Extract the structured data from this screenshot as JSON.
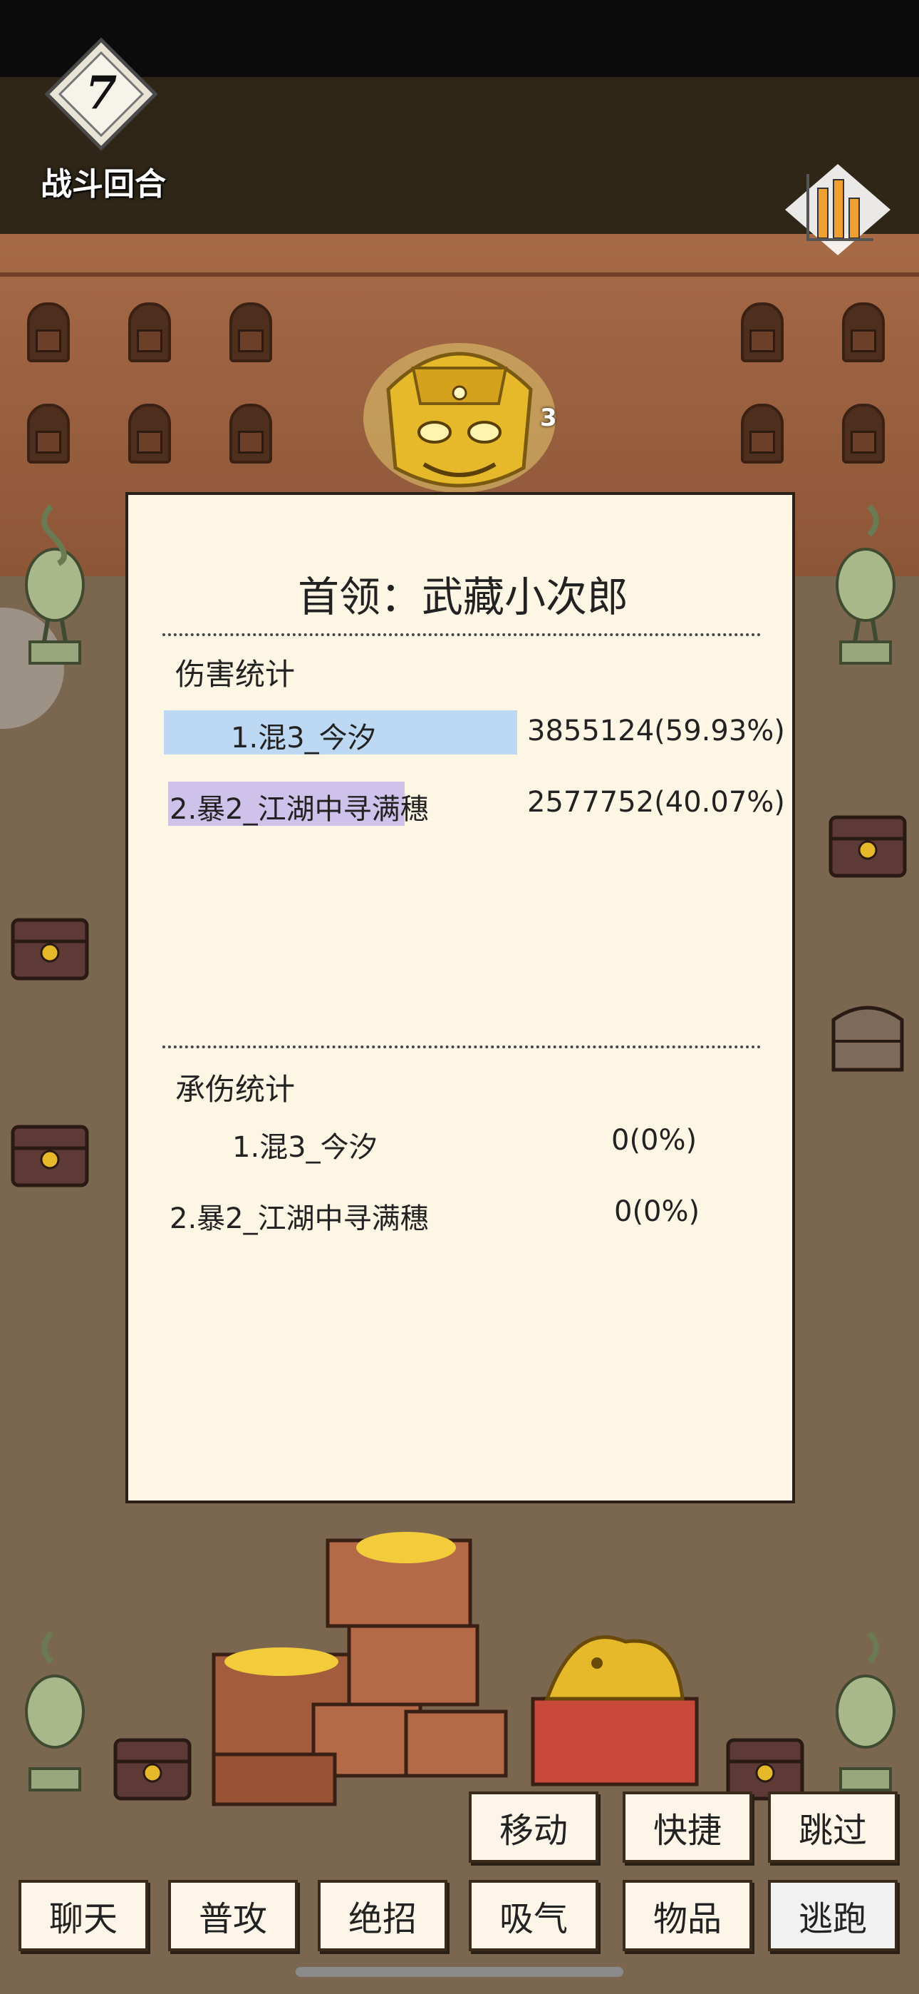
{
  "hud": {
    "round_number": "7",
    "round_label": "战斗回合"
  },
  "boss": {
    "level": "3"
  },
  "panel": {
    "title": "首领：武藏小次郎",
    "damage_section": {
      "title": "伤害统计",
      "rows": [
        {
          "name": "1.混3_今汐",
          "value": "3855124(59.93%)",
          "share": 0.5993,
          "bar_color": "#bcd8f2"
        },
        {
          "name": "2.暴2_江湖中寻满穗",
          "value": "2577752(40.07%)",
          "share": 0.4007,
          "bar_color": "#cfc2ea"
        }
      ]
    },
    "taken_section": {
      "title": "承伤统计",
      "rows": [
        {
          "name": "1.混3_今汐",
          "value": "0(0%)"
        },
        {
          "name": "2.暴2_江湖中寻满穗",
          "value": "0(0%)"
        }
      ]
    }
  },
  "actions": {
    "top_row": [
      "移动",
      "快捷",
      "跳过"
    ],
    "bottom_row": [
      "聊天",
      "普攻",
      "绝招",
      "吸气",
      "物品",
      "逃跑"
    ]
  },
  "icons": {
    "round_badge": "diamond-badge-icon",
    "stats": "bar-chart-icon",
    "boss": "golden-mask-icon",
    "treasure": "treasure-chest-icon",
    "crane": "crane-lamp-icon"
  },
  "colors": {
    "panel_bg": "#fdf6e5",
    "wall": "#9a603f",
    "ground": "#7b6650",
    "gold": "#e6b92a"
  }
}
